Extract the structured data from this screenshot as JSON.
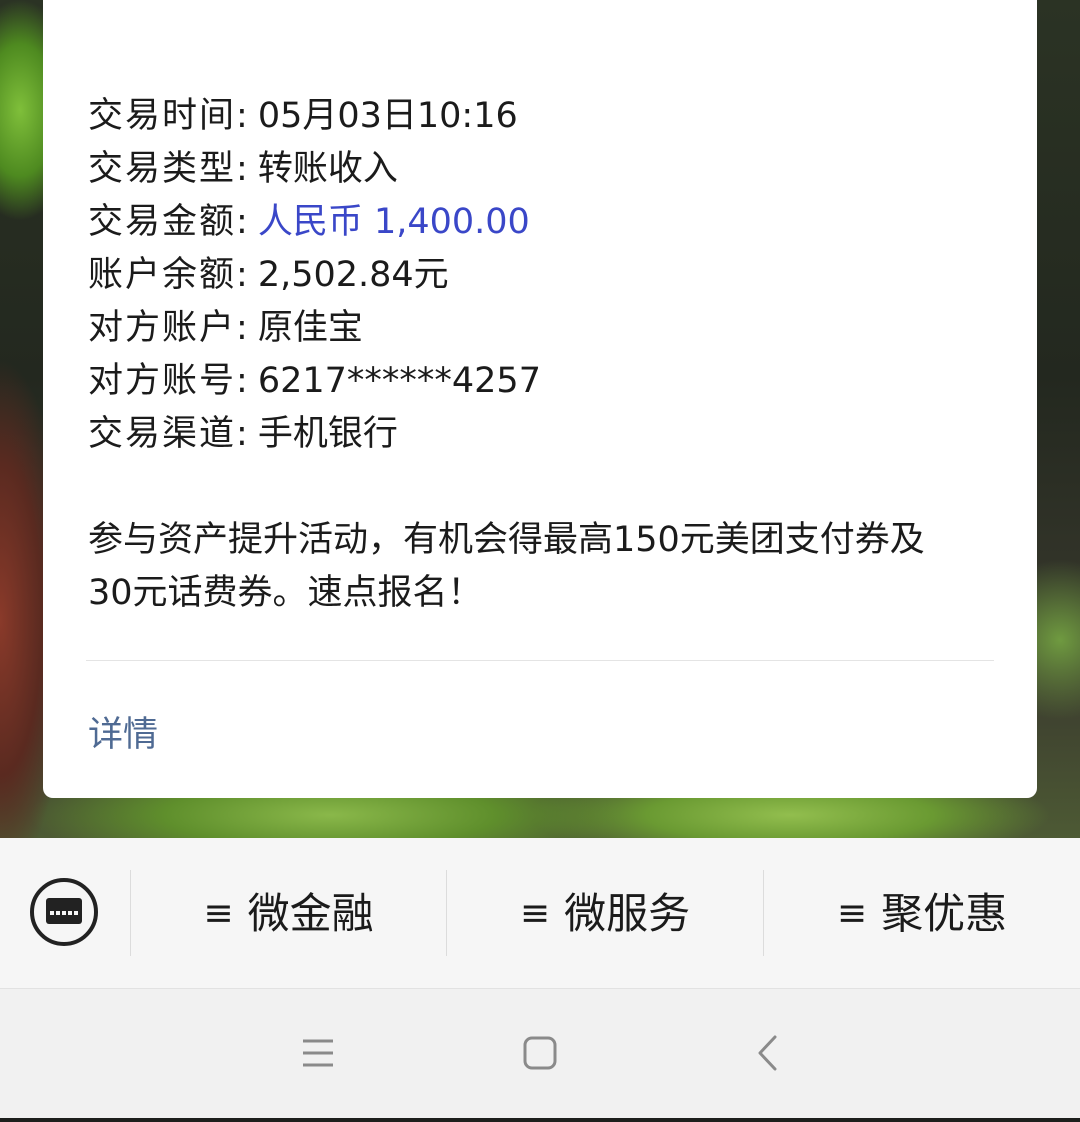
{
  "message": {
    "rows": [
      {
        "key": "交易时间",
        "sep": ":",
        "value": "05月03日10:16"
      },
      {
        "key": "交易类型",
        "sep": ":",
        "value": "转账收入"
      },
      {
        "key": "交易金额",
        "sep": ":",
        "value": "人民币 1,400.00"
      },
      {
        "key": "账户余额",
        "sep": ":",
        "value": "2,502.84元"
      },
      {
        "key": "对方账户",
        "sep": ":",
        "value": "原佳宝"
      },
      {
        "key": "对方账号",
        "sep": ":",
        "value": "6217******4257"
      },
      {
        "key": "交易渠道",
        "sep": ":",
        "value": "手机银行"
      }
    ],
    "promo_line1": "参与资产提升活动，有机会得最高150元美团支付券及",
    "promo_line2": "30元话费券。速点报名！",
    "detail_label": "详情"
  },
  "menu": {
    "items": [
      {
        "icon": "≡",
        "label": "微金融"
      },
      {
        "icon": "≡",
        "label": "微服务"
      },
      {
        "icon": "≡",
        "label": "聚优惠"
      }
    ]
  },
  "colors": {
    "amount_blue": "#3a47c8",
    "link_blue": "#4f6a93"
  },
  "icons": {
    "keyboard": "keyboard-icon",
    "nav_menu": "menu-icon",
    "nav_home": "home-icon",
    "nav_back": "back-icon"
  }
}
